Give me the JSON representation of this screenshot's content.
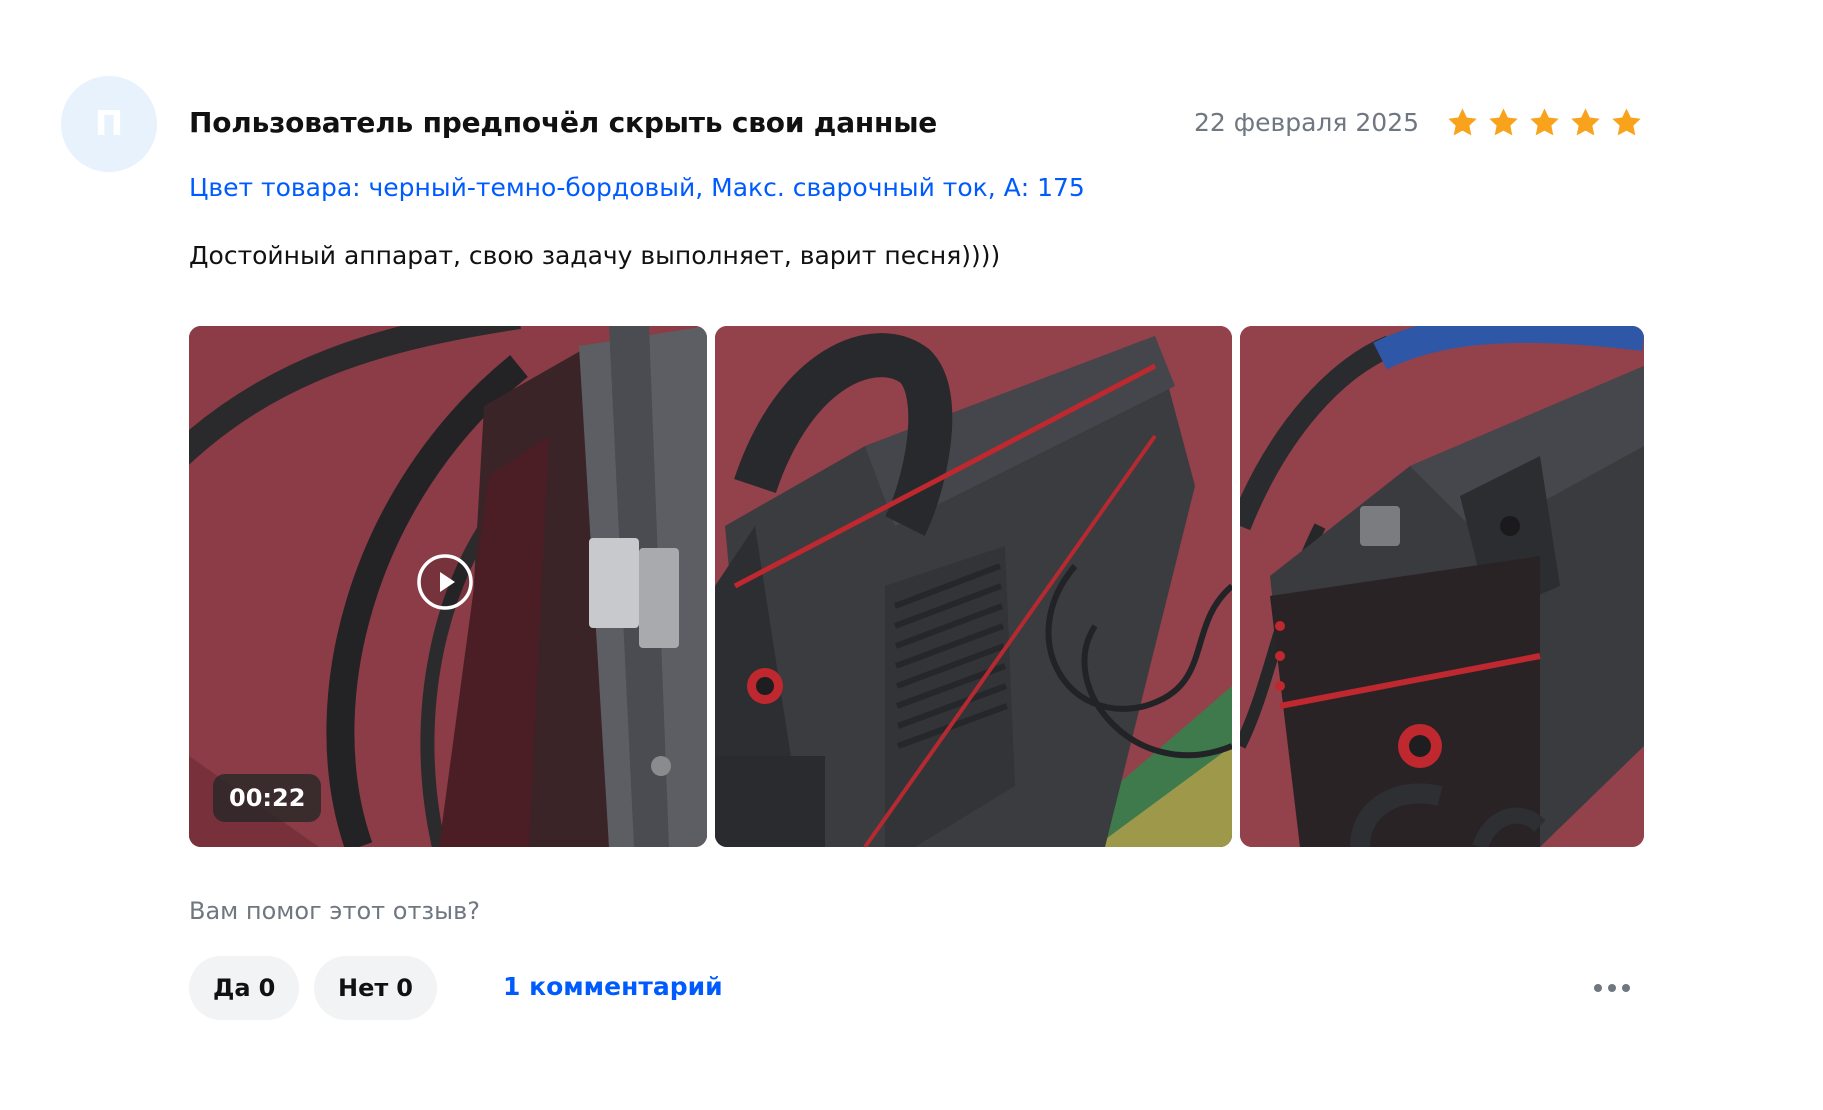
{
  "review": {
    "avatar_letter": "П",
    "author": "Пользователь предпочёл скрыть свои данные",
    "date": "22 февраля 2025",
    "rating": 5,
    "rating_max": 5,
    "variant": "Цвет товара: черный-темно-бордовый, Макс. сварочный ток, А: 175",
    "text": "Достойный аппарат, свою задачу выполняет, варит песня))))"
  },
  "media": [
    {
      "type": "video",
      "duration": "00:22",
      "icon": "play-icon"
    },
    {
      "type": "photo"
    },
    {
      "type": "photo"
    }
  ],
  "feedback": {
    "question": "Вам помог этот отзыв?",
    "yes_label": "Да",
    "yes_count": "0",
    "no_label": "Нет",
    "no_count": "0",
    "comments": "1 комментарий",
    "more_icon": "more-dots-icon"
  },
  "colors": {
    "accent": "#005bff",
    "star": "#f9a21b",
    "muted": "#6f7780",
    "chip_bg": "#f2f3f5"
  }
}
